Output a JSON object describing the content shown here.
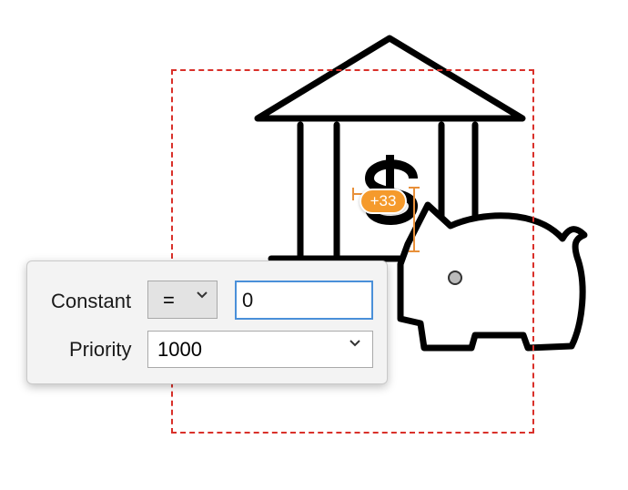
{
  "canvas": {
    "image_icon": "bank-piggybank-icon",
    "constraint_badge": "+33",
    "selection_color": "#d9302a",
    "badge_color": "#f59a2c"
  },
  "constraint_popover": {
    "constant_label": "Constant",
    "relation_value": "=",
    "constant_value": "0",
    "priority_label": "Priority",
    "priority_value": "1000"
  }
}
